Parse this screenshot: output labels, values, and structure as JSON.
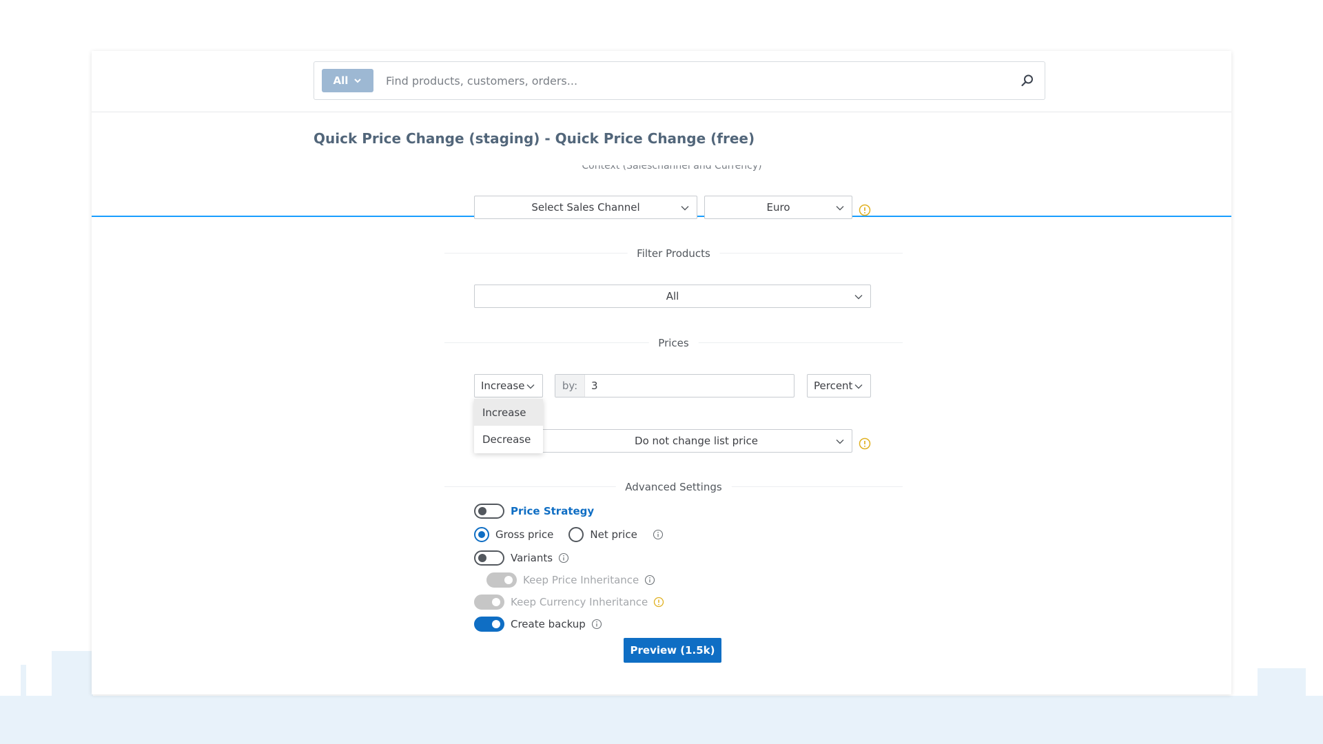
{
  "search": {
    "type_label": "All",
    "placeholder": "Find products, customers, orders..."
  },
  "page_title": "Quick Price Change (staging) - Quick Price Change (free)",
  "context": {
    "section_label": "Context (Saleschannel and Currency)",
    "sales_channel": "Select Sales Channel",
    "currency": "Euro"
  },
  "filter_products": {
    "section_label": "Filter Products",
    "value": "All"
  },
  "prices": {
    "section_label": "Prices",
    "mode": "Increase",
    "mode_options": [
      "Increase",
      "Decrease"
    ],
    "by_label": "by:",
    "by_value": "3",
    "unit": "Percent",
    "list_price": "Do not change list price"
  },
  "advanced": {
    "section_label": "Advanced Settings",
    "price_strategy": "Price Strategy",
    "gross_price": "Gross price",
    "net_price": "Net price",
    "variants": "Variants",
    "keep_price_inheritance": "Keep Price Inheritance",
    "keep_currency_inheritance": "Keep Currency Inheritance",
    "create_backup": "Create backup"
  },
  "preview_button": "Preview (1.5k)",
  "colors": {
    "accent": "#0f6ec4",
    "header_border": "#189eff",
    "warning": "#e0b020"
  }
}
